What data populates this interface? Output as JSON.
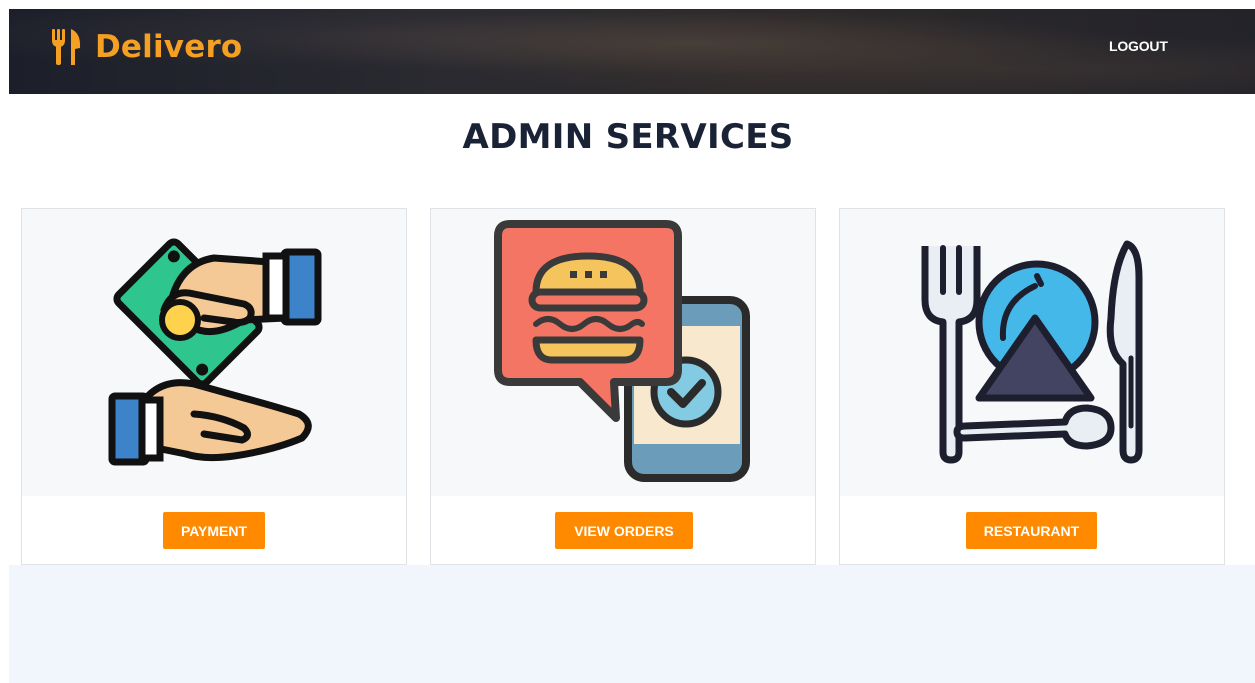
{
  "header": {
    "brand_name": "Delivero",
    "logout_label": "LOGOUT"
  },
  "page": {
    "title": "ADMIN SERVICES"
  },
  "services": [
    {
      "icon": "payment-hands-cash-icon",
      "button_label": "PAYMENT"
    },
    {
      "icon": "burger-order-phone-icon",
      "button_label": "VIEW ORDERS"
    },
    {
      "icon": "restaurant-plate-cutlery-icon",
      "button_label": "RESTAURANT"
    }
  ],
  "colors": {
    "brand": "#f5a023",
    "button": "#ff8a00",
    "heading": "#1a2236",
    "lower_band": "#f0f6fc"
  }
}
